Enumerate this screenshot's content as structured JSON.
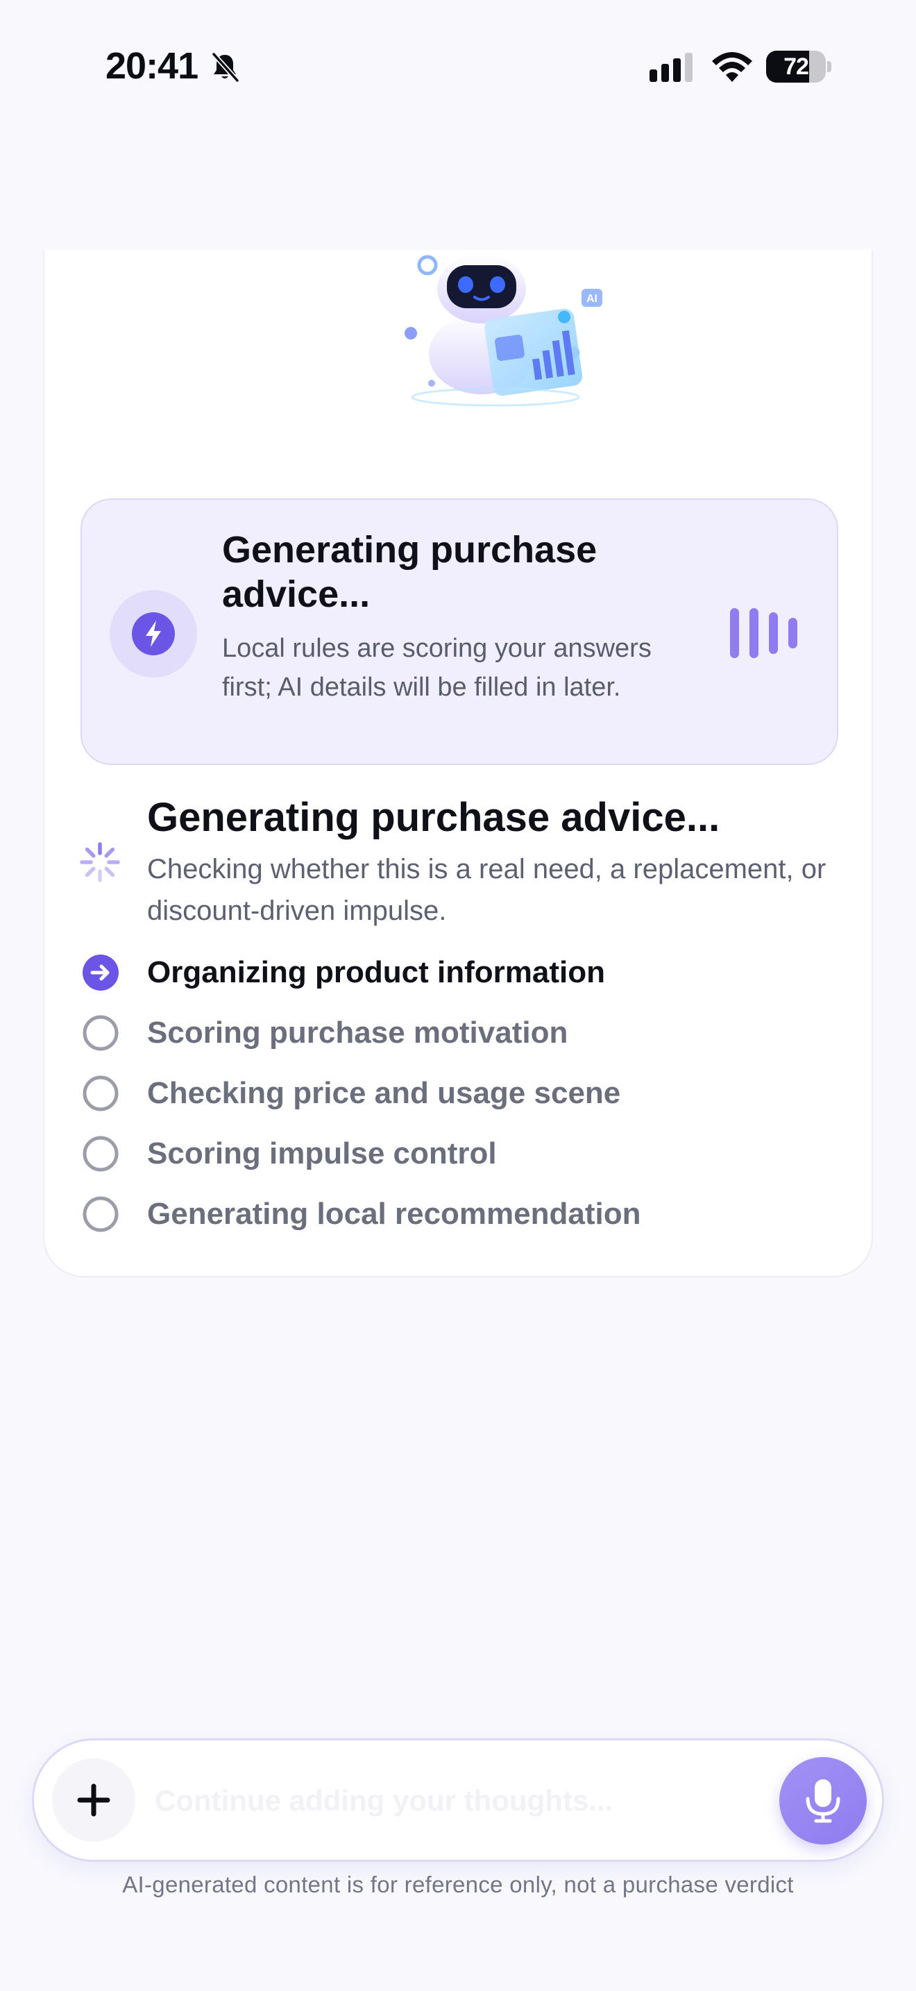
{
  "status_bar": {
    "time": "20:41",
    "battery_percent": "72",
    "battery_level": 0.72,
    "icons": [
      "bell-slash-icon",
      "cellular-signal-icon",
      "wifi-icon",
      "battery-icon"
    ]
  },
  "card": {
    "mascot_icon": "robot-shopping-analysis-illustration",
    "mascot_badge": "AI",
    "generating": {
      "title": "Generating purchase advice...",
      "subtitle": "Local rules are scoring your answers first; AI details will be filled in later.",
      "icon": "lightning-bolt-icon",
      "indicator_icon": "audio-wave-icon"
    },
    "section": {
      "title": "Generating purchase advice...",
      "subtitle": "Checking whether this is a real need, a replacement, or discount-driven impulse.",
      "icon": "loading-spinner-icon"
    },
    "steps": [
      {
        "label": "Organizing product information",
        "status": "active"
      },
      {
        "label": "Scoring purchase motivation",
        "status": "pending"
      },
      {
        "label": "Checking price and usage scene",
        "status": "pending"
      },
      {
        "label": "Scoring impulse control",
        "status": "pending"
      },
      {
        "label": "Generating local recommendation",
        "status": "pending"
      }
    ]
  },
  "composer": {
    "placeholder": "Continue adding your thoughts...",
    "value": "",
    "add_icon": "plus-icon",
    "mic_icon": "microphone-icon"
  },
  "footer": {
    "disclaimer": "AI-generated content is for reference only, not a purchase verdict"
  },
  "colors": {
    "accent": "#6a55e6",
    "accent_light": "#f1effd",
    "background": "#f8f8fd",
    "text_primary": "#0f1018",
    "text_secondary": "#6b6f7d"
  }
}
